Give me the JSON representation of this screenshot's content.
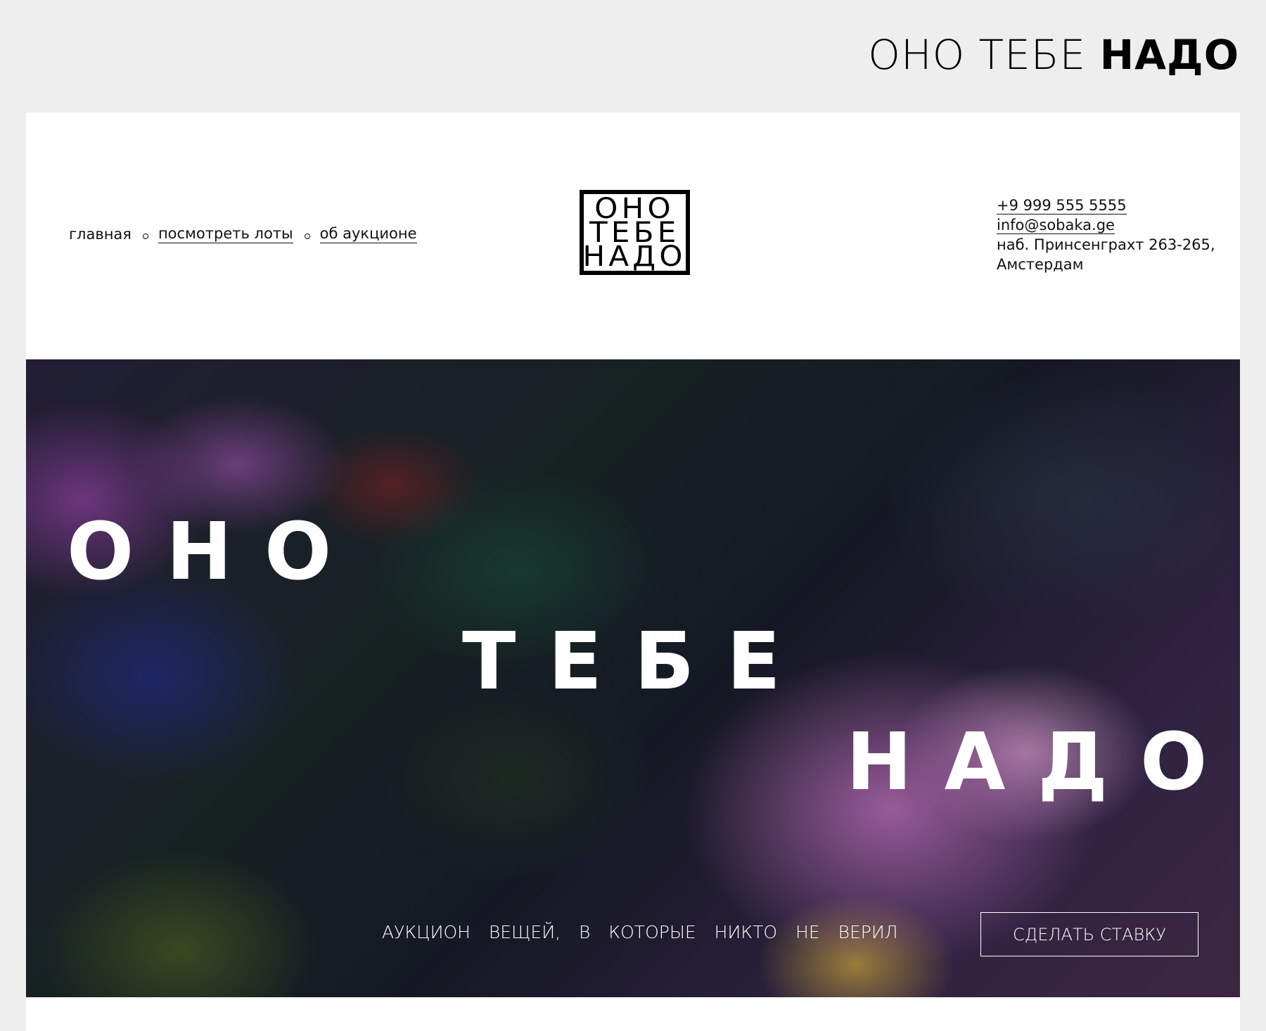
{
  "brand": {
    "title_light": "ОНО ТЕБЕ",
    "title_bold": "НАДО"
  },
  "nav": {
    "items": [
      {
        "label": "главная"
      },
      {
        "label": "посмотреть лоты"
      },
      {
        "label": "об аукционе"
      }
    ]
  },
  "logo": {
    "lines": [
      "ОНО",
      "ТЕБЕ",
      "НАДО"
    ]
  },
  "contacts": {
    "phone": "+9 999 555 5555",
    "email": "info@sobaka.ge",
    "address_line1": "наб. Принсенграхт 263-265,",
    "address_line2": "Амстердам"
  },
  "hero": {
    "word1": "ОНО",
    "word2": "ТЕБЕ",
    "word3": "НАДО",
    "tagline": "АУКЦИОН ВЕЩЕЙ, В КОТОРЫЕ НИКТО НЕ ВЕРИЛ",
    "cta_label": "СДЕЛАТЬ СТАВКУ"
  }
}
